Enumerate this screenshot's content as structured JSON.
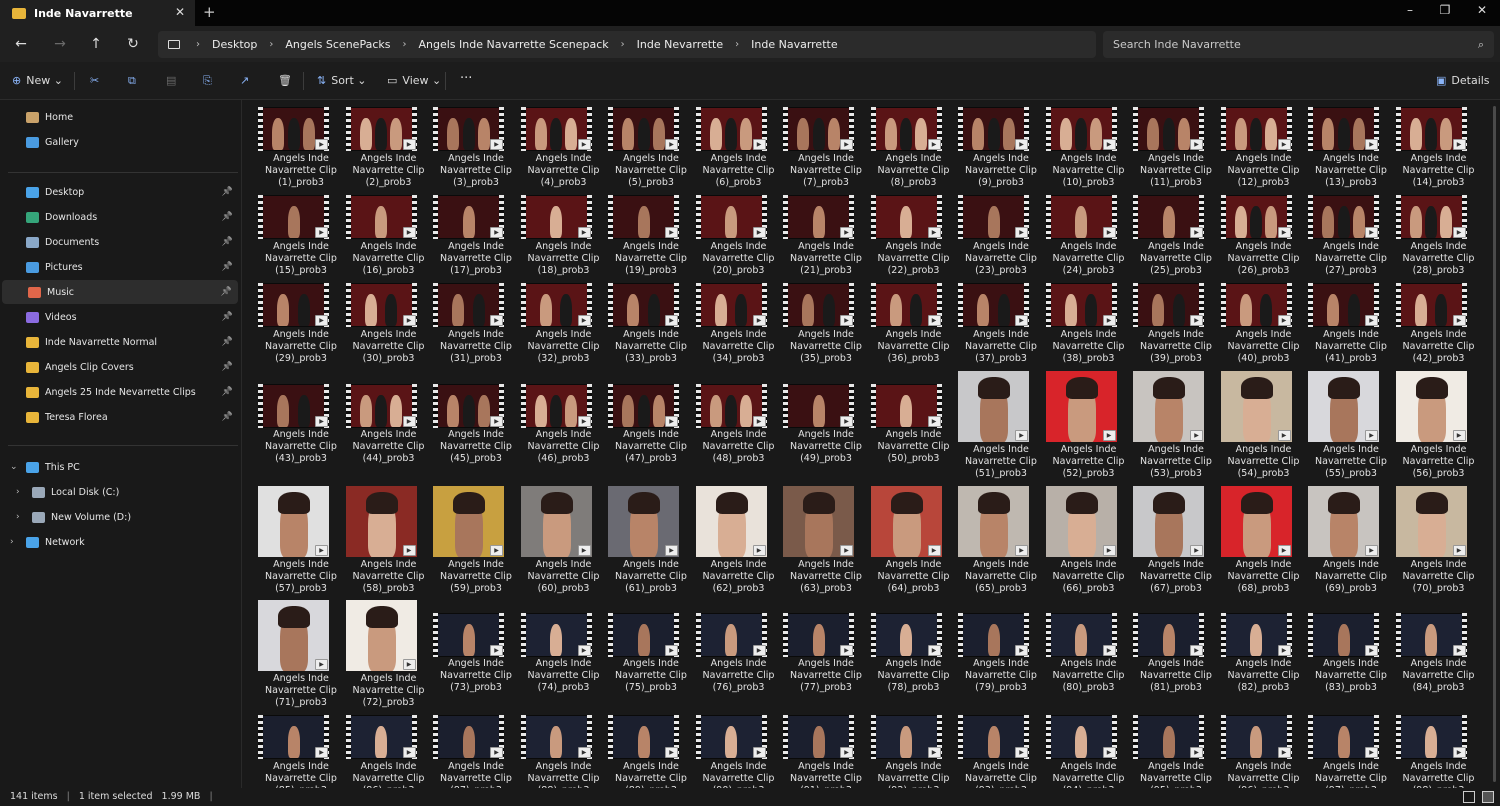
{
  "window": {
    "tab_title": "Inde Navarrette"
  },
  "breadcrumb": [
    "Desktop",
    "Angels ScenePacks",
    "Angels Inde Navarrette Scenepack",
    "Inde Nevarrette",
    "Inde Navarrette"
  ],
  "search": {
    "placeholder": "Search Inde Navarrette"
  },
  "toolbar": {
    "new_label": "New",
    "sort_label": "Sort",
    "view_label": "View",
    "details_label": "Details"
  },
  "sidebar": {
    "top": [
      {
        "label": "Home",
        "icon": "home-icon"
      },
      {
        "label": "Gallery",
        "icon": "gallery-icon"
      }
    ],
    "pinned": [
      {
        "label": "Desktop",
        "icon": "desktop-icon",
        "color": "#4aa3e8"
      },
      {
        "label": "Downloads",
        "icon": "download-icon",
        "color": "#35a57a"
      },
      {
        "label": "Documents",
        "icon": "document-icon",
        "color": "#8aa8c8"
      },
      {
        "label": "Pictures",
        "icon": "pictures-icon",
        "color": "#4a9be0"
      },
      {
        "label": "Music",
        "icon": "music-icon",
        "color": "#e0664a"
      },
      {
        "label": "Videos",
        "icon": "videos-icon",
        "color": "#8b6be0"
      },
      {
        "label": "Inde Navarrette Normal",
        "icon": "folder-icon",
        "color": "#e8b53a"
      },
      {
        "label": "Angels Clip Covers",
        "icon": "folder-icon",
        "color": "#e8b53a"
      },
      {
        "label": "Angels 25 Inde Nevarrette Clips",
        "icon": "folder-icon",
        "color": "#e8b53a"
      },
      {
        "label": "Teresa Florea",
        "icon": "folder-icon",
        "color": "#e8b53a"
      }
    ],
    "this_pc": {
      "label": "This PC"
    },
    "drives": [
      {
        "label": "Local Disk (C:)"
      },
      {
        "label": "New Volume (D:)"
      }
    ],
    "network": {
      "label": "Network"
    }
  },
  "files": {
    "name_prefix": "Angels Inde Navarrette Clip",
    "name_suffix_pattern": "({n})_prob3",
    "count_shown": 98
  },
  "status": {
    "items": "141 items",
    "selected": "1 item selected",
    "size": "1.99 MB"
  }
}
